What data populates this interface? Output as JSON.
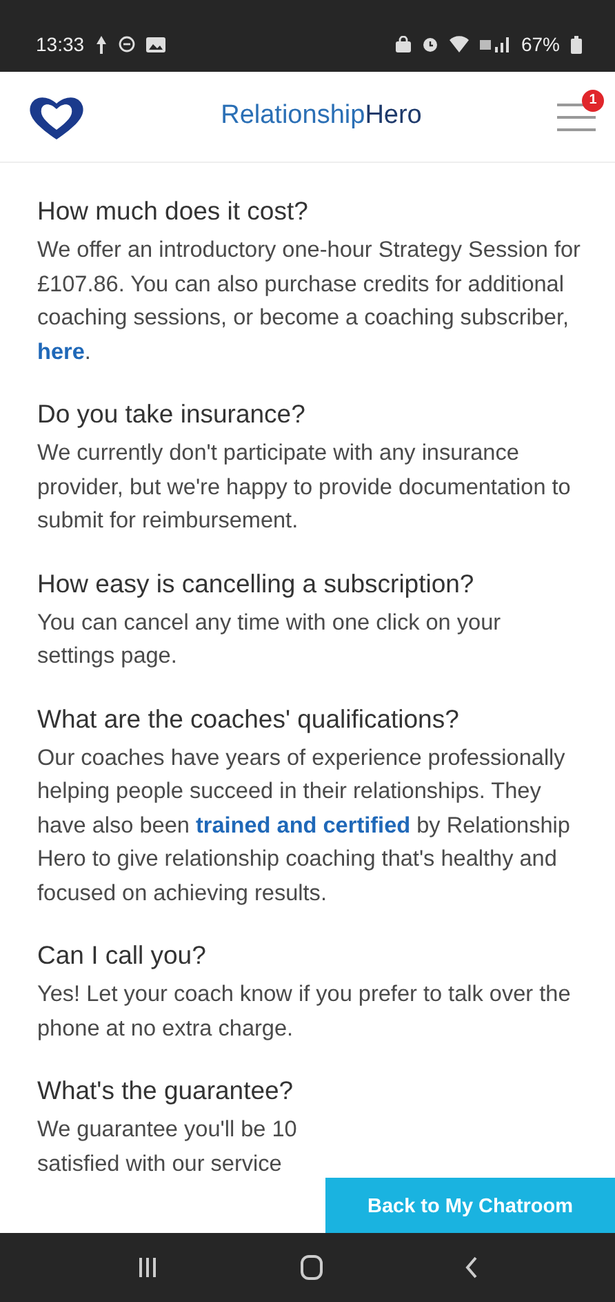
{
  "status_bar": {
    "time": "13:33",
    "battery": "67%"
  },
  "header": {
    "brand": [
      {
        "text": "Relationship",
        "kind": "accent"
      },
      {
        "text": "Hero",
        "kind": "plain"
      }
    ],
    "menu_badge": "1"
  },
  "faqs": [
    {
      "question": "How much does it cost?",
      "answer": [
        {
          "text": "We offer an introductory one-hour Strategy Session for £107.86. You can also purchase credits for additional coaching sessions, or become a coaching subscriber, ",
          "kind": "text"
        },
        {
          "text": "here",
          "kind": "link"
        },
        {
          "text": ".",
          "kind": "text"
        }
      ]
    },
    {
      "question": "Do you take insurance?",
      "answer": [
        {
          "text": "We currently don't participate with any insurance provider, but we're happy to provide documentation to submit for reimbursement.",
          "kind": "text"
        }
      ]
    },
    {
      "question": "How easy is cancelling a subscription?",
      "answer": [
        {
          "text": "You can cancel any time with one click on your settings page.",
          "kind": "text"
        }
      ]
    },
    {
      "question": "What are the coaches' qualifications?",
      "answer": [
        {
          "text": "Our coaches have years of experience professionally helping people succeed in their relationships. They have also been ",
          "kind": "text"
        },
        {
          "text": "trained and certified",
          "kind": "link"
        },
        {
          "text": " by Relationship Hero to give relationship coaching that's healthy and focused on achieving results.",
          "kind": "text"
        }
      ]
    },
    {
      "question": "Can I call you?",
      "answer": [
        {
          "text": "Yes! Let your coach know if you prefer to talk over the phone at no extra charge.",
          "kind": "text"
        }
      ]
    },
    {
      "question": "What's the guarantee?",
      "answer_lines": [
        "We guarantee you'll be 10",
        "satisfied with our service"
      ]
    }
  ],
  "chat_button": "Back to My Chatroom"
}
